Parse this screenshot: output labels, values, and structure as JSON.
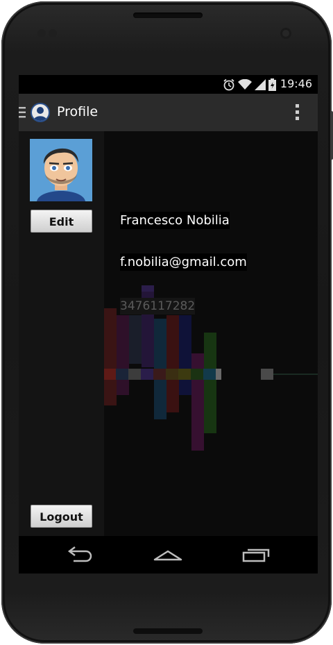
{
  "status_bar": {
    "time": "19:46",
    "icons": [
      "alarm-icon",
      "wifi-icon",
      "signal-icon",
      "battery-icon"
    ]
  },
  "action_bar": {
    "title": "Profile",
    "drawer_icon": "drawer-icon",
    "overflow_icon": "overflow-menu-icon"
  },
  "profile": {
    "name": "Francesco Nobilia",
    "email": "f.nobilia@gmail.com",
    "phone": "3476117282",
    "edit_label": "Edit",
    "logout_label": "Logout"
  },
  "nav_bar": {
    "icons": [
      "back-icon",
      "home-icon",
      "recents-icon"
    ]
  },
  "colors": {
    "actionbar": "#2b2b2b",
    "panel": "#141414",
    "background": "#0b0b0b"
  }
}
